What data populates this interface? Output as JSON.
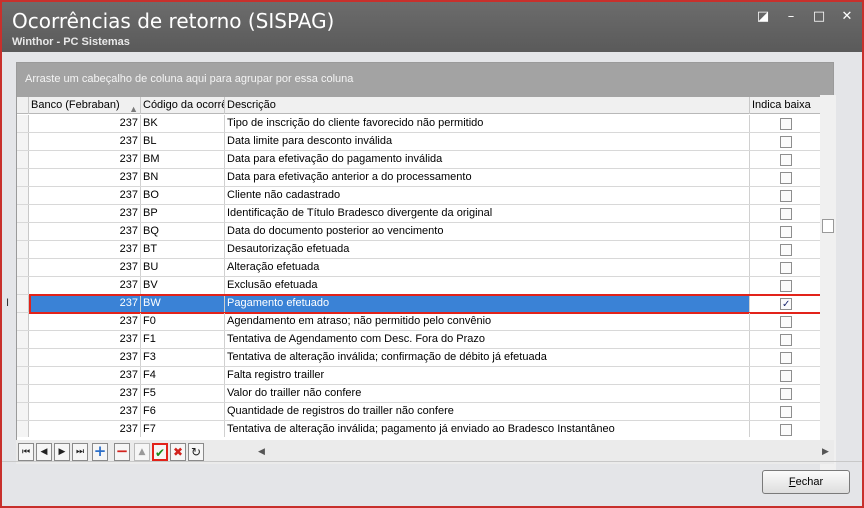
{
  "window": {
    "title": "Ocorrências de retorno (SISPAG)",
    "subtitle": "Winthor - PC Sistemas",
    "controls": [
      "restore-icon",
      "minimize-icon",
      "maximize-icon",
      "close-icon"
    ]
  },
  "grid": {
    "group_hint": "Arraste um cabeçalho de coluna aqui para agrupar por essa coluna",
    "columns": [
      "Banco (Febraban)",
      "Código da ocorrê",
      "Descrição",
      "Indica baixa"
    ],
    "sort_column": "Banco (Febraban)",
    "rows": [
      {
        "banco": "237",
        "codigo": "BK",
        "descricao": "Tipo de inscrição do cliente favorecido não permitido",
        "baixa": false
      },
      {
        "banco": "237",
        "codigo": "BL",
        "descricao": "Data limite para desconto inválida",
        "baixa": false
      },
      {
        "banco": "237",
        "codigo": "BM",
        "descricao": "Data para efetivação do pagamento inválida",
        "baixa": false
      },
      {
        "banco": "237",
        "codigo": "BN",
        "descricao": "Data para efetivação anterior a do processamento",
        "baixa": false
      },
      {
        "banco": "237",
        "codigo": "BO",
        "descricao": "Cliente não cadastrado",
        "baixa": false
      },
      {
        "banco": "237",
        "codigo": "BP",
        "descricao": "Identificação de Título Bradesco divergente da original",
        "baixa": false
      },
      {
        "banco": "237",
        "codigo": "BQ",
        "descricao": "Data do documento posterior ao vencimento",
        "baixa": false
      },
      {
        "banco": "237",
        "codigo": "BT",
        "descricao": "Desautorização efetuada",
        "baixa": false
      },
      {
        "banco": "237",
        "codigo": "BU",
        "descricao": "Alteração efetuada",
        "baixa": false
      },
      {
        "banco": "237",
        "codigo": "BV",
        "descricao": "Exclusão efetuada",
        "baixa": false
      },
      {
        "banco": "237",
        "codigo": "BW",
        "descricao": "Pagamento efetuado",
        "baixa": true,
        "selected": true
      },
      {
        "banco": "237",
        "codigo": "F0",
        "descricao": "Agendamento em atraso; não permitido pelo convênio",
        "baixa": false
      },
      {
        "banco": "237",
        "codigo": "F1",
        "descricao": "Tentativa de Agendamento com Desc. Fora do Prazo",
        "baixa": false
      },
      {
        "banco": "237",
        "codigo": "F3",
        "descricao": "Tentativa de alteração inválida; confirmação de débito já efetuada",
        "baixa": false
      },
      {
        "banco": "237",
        "codigo": "F4",
        "descricao": "Falta registro trailler",
        "baixa": false
      },
      {
        "banco": "237",
        "codigo": "F5",
        "descricao": "Valor do trailler não confere",
        "baixa": false
      },
      {
        "banco": "237",
        "codigo": "F6",
        "descricao": "Quantidade de registros do trailler não confere",
        "baixa": false
      },
      {
        "banco": "237",
        "codigo": "F7",
        "descricao": "Tentativa de alteração inválida; pagamento já enviado ao Bradesco Instantâneo",
        "baixa": false
      }
    ]
  },
  "navigator": {
    "buttons": [
      "first-icon",
      "prior-icon",
      "next-icon",
      "last-icon",
      "insert-icon",
      "delete-icon",
      "edit-up-icon",
      "post-icon",
      "cancel-icon",
      "refresh-icon"
    ]
  },
  "footer": {
    "close_label_first": "F",
    "close_label_rest": "echar"
  },
  "colors": {
    "selection": "#3a82d6",
    "highlight_border": "#e2231a",
    "titlebar": "#646464"
  }
}
